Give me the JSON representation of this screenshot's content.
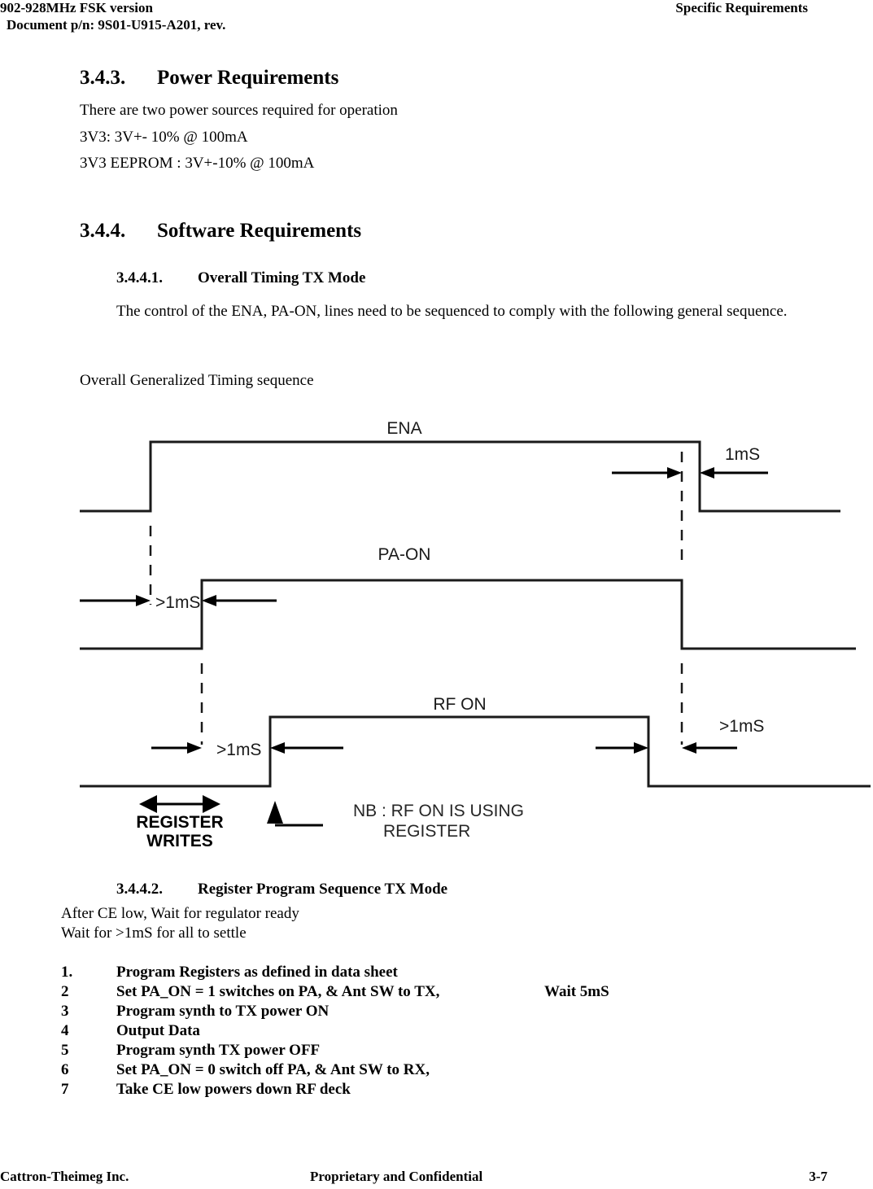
{
  "header": {
    "left_line1": "902-928MHz FSK version",
    "left_line2": "Document p/n: 9S01-U915-A201, rev.",
    "right": "Specific Requirements"
  },
  "sections": {
    "power": {
      "number": "3.4.3.",
      "title": "Power Requirements",
      "intro": "There are two power sources required for  operation",
      "supply_1": "3V3:  3V+- 10% @ 100mA",
      "supply_2": "3V3 EEPROM : 3V+-10% @ 100mA"
    },
    "software": {
      "number": "3.4.4.",
      "title": "Software Requirements"
    },
    "overall_timing": {
      "number": "3.4.4.1.",
      "title": "Overall Timing TX Mode",
      "paragraph": "The control of the ENA, PA-ON, lines need to be sequenced to comply with the following general sequence.",
      "caption": "Overall Generalized Timing sequence"
    },
    "register_sequence": {
      "number": "3.4.4.2.",
      "title": "Register Program Sequence TX Mode",
      "preamble_line1": "After CE low, Wait for regulator ready",
      "preamble_line2": "Wait for >1mS for all to settle",
      "steps": [
        {
          "num": "1.",
          "text": "Program Registers as defined in data sheet",
          "note": ""
        },
        {
          "num": "2",
          "text": "Set PA_ON = 1   switches on PA, & Ant SW to TX,",
          "note": "Wait 5mS"
        },
        {
          "num": "3",
          "text": "Program synth to TX power ON",
          "note": ""
        },
        {
          "num": "4",
          "text": "Output Data",
          "note": ""
        },
        {
          "num": "5",
          "text": "Program synth TX power OFF",
          "note": ""
        },
        {
          "num": "6",
          "text": "Set PA_ON = 0   switch off PA, & Ant SW to RX,",
          "note": ""
        },
        {
          "num": "7",
          "text": "Take CE low powers down RF deck",
          "note": ""
        }
      ]
    }
  },
  "timing_diagram": {
    "signals": [
      {
        "name": "ENA",
        "label": "ENA"
      },
      {
        "name": "PA-ON",
        "label": "PA-ON"
      },
      {
        "name": "RF ON",
        "label": "RF ON"
      }
    ],
    "annotations": {
      "ena_fall": "1mS",
      "paon_rise": ">1mS",
      "rfon_rise": ">1mS",
      "rfon_fall": ">1mS"
    },
    "legend": {
      "register_writes_line1": "REGISTER",
      "register_writes_line2": "WRITES",
      "note_line1": "NB :  RF ON IS USING",
      "note_line2": "REGISTER"
    }
  },
  "footer": {
    "left": "Cattron-Theimeg Inc.",
    "center": "Proprietary and Confidential",
    "right": "3-7"
  }
}
